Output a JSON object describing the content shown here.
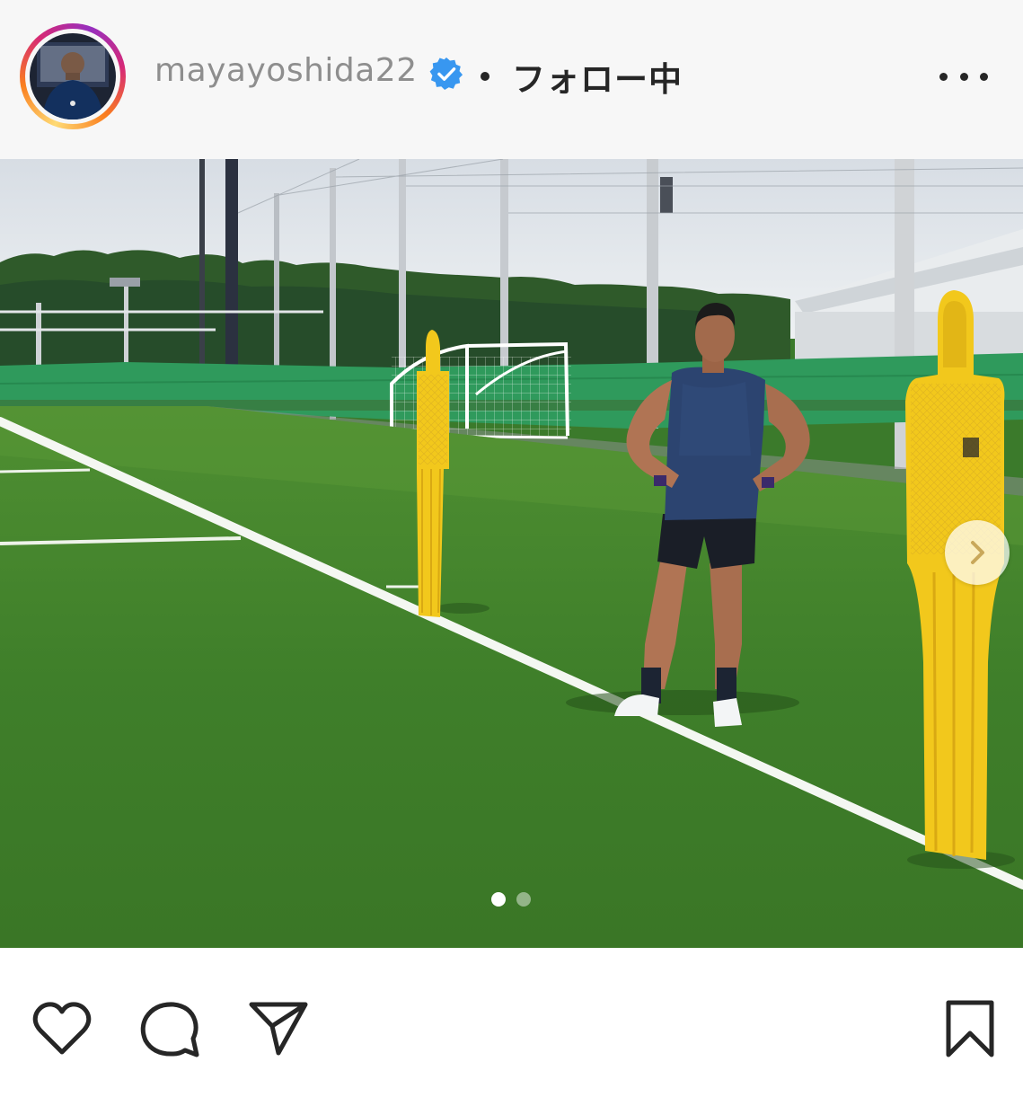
{
  "post": {
    "username": "mayayoshida22",
    "follow_status": "フォロー中",
    "verified": true
  },
  "icons": {
    "more": "more-options-icon",
    "verified": "verified-badge-icon",
    "next": "chevron-right-icon",
    "like": "heart-icon",
    "comment": "comment-bubble-icon",
    "share": "paper-plane-icon",
    "save": "bookmark-icon"
  },
  "carousel": {
    "current": 1,
    "total": 2
  },
  "colors": {
    "verified_blue": "#3897f0",
    "text": "#262626",
    "muted": "#8e8e8e"
  }
}
